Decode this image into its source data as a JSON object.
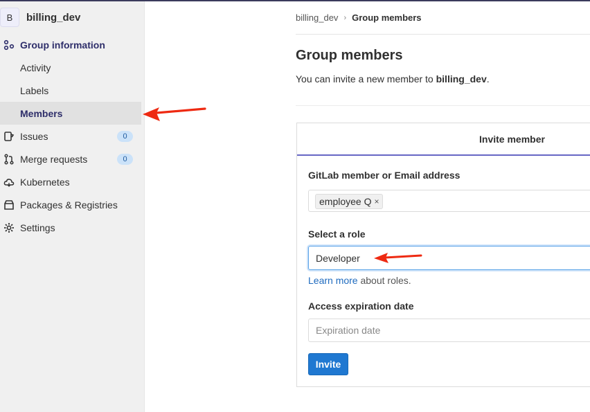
{
  "sidebar": {
    "avatar_letter": "B",
    "group_name": "billing_dev",
    "items": [
      {
        "label": "Group information",
        "icon": "group-info-icon",
        "level": "top"
      },
      {
        "label": "Activity",
        "level": "sub"
      },
      {
        "label": "Labels",
        "level": "sub"
      },
      {
        "label": "Members",
        "level": "sub",
        "active": true
      },
      {
        "label": "Issues",
        "icon": "issues-icon",
        "badge": "0"
      },
      {
        "label": "Merge requests",
        "icon": "merge-request-icon",
        "badge": "0"
      },
      {
        "label": "Kubernetes",
        "icon": "kubernetes-icon"
      },
      {
        "label": "Packages & Registries",
        "icon": "package-icon"
      },
      {
        "label": "Settings",
        "icon": "gear-icon"
      }
    ]
  },
  "breadcrumb": {
    "parent": "billing_dev",
    "separator": "›",
    "current": "Group members"
  },
  "main": {
    "title": "Group members",
    "intro_prefix": "You can invite a new member to ",
    "intro_group": "billing_dev",
    "intro_suffix": "."
  },
  "invite": {
    "tab_label": "Invite member",
    "member_label": "GitLab member or Email address",
    "member_token": "employee Q",
    "token_remove": "×",
    "role_label": "Select a role",
    "role_value": "Developer",
    "learn_link": "Learn more",
    "learn_suffix": " about roles.",
    "expiry_label": "Access expiration date",
    "expiry_placeholder": "Expiration date",
    "invite_button": "Invite"
  },
  "colors": {
    "annotation_arrow": "#ee2a12",
    "primary_button": "#1f78d1",
    "badge_bg": "#cbe2f9",
    "active_tab_border": "#6666c4"
  }
}
